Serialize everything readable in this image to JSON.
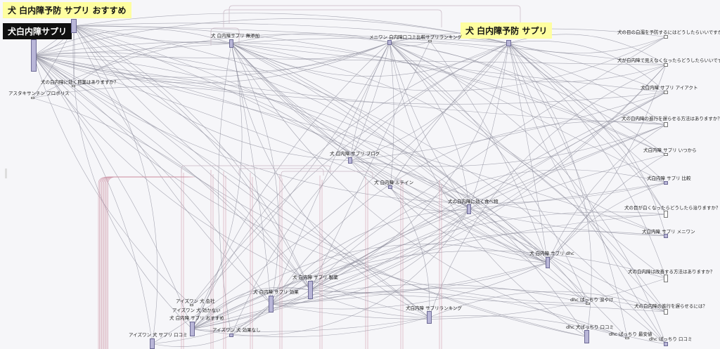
{
  "highlights": {
    "top_left": "犬 白内障予防 サプリ おすすめ",
    "root": "犬白内障サプリ",
    "top_right": "犬 白内障予防 サプリ"
  },
  "labels": {
    "mutenka": "犬 白内障サプリ 無添加",
    "meniwan": "メニワン 白内障口コミ比較サプリランキング",
    "kiku_meyaku": "犬の白内障に効く目薬はありますか？",
    "astaxanthin": "アスタキサンチン プロポリス",
    "q_yobou": "犬の目の白濁を予防するにはどうしたらいいですか？",
    "q_mienaku": "犬が白内障で見えなくなったらどうしたらいいですか？",
    "aiact": "犬白内障 サプリ アイアクト",
    "q_shinkou": "犬の白内障の進行を遅らせる方法はありますか？",
    "blog": "犬 白内障 サプリ ブログ",
    "itsukara": "犬白内障 サプリ いつから",
    "lutein": "犬 白内障 ルテイン",
    "hikaku": "犬白内障 サプリ 比較",
    "tabemono": "犬の白内障に効く食べ物",
    "q_shiroku": "犬の目が白くなったらどうしたら治りますか？",
    "meniwan2": "犬白内障 サプリ メニワン",
    "dhc": "犬 白内障 サプリ dhc",
    "q_kaizen": "犬の白内障は改善する方法はありますか？",
    "seiyaku": "犬 白内障 サプリ 製薬",
    "kouka": "犬 白内障 サプリ 効果",
    "aiwan_kaisha": "アイズワン 犬 会社",
    "aiwan_kikanai": "アイズワン 犬 効かない",
    "osusume": "犬 白内障 サプリ おすすめ",
    "dhc_namida": "dhc ぱっちり 涙やけ",
    "ranking": "犬白内障 サプリランキング",
    "q_okuraseru": "犬の白内障の進行を遅らせるには？",
    "aiwan_kuchikomi": "アイズワン 犬 サプリ 口コミ",
    "aiwan_kouka": "アイズワン 犬 効果なし",
    "dhc_kuchikomi": "dhc 犬ぱっちり 口コミ",
    "dhc_saiyasu": "dhc ぱっちり 最安値",
    "dhc_kuchikomi2": "dhc ぱっちり 口コミ"
  }
}
